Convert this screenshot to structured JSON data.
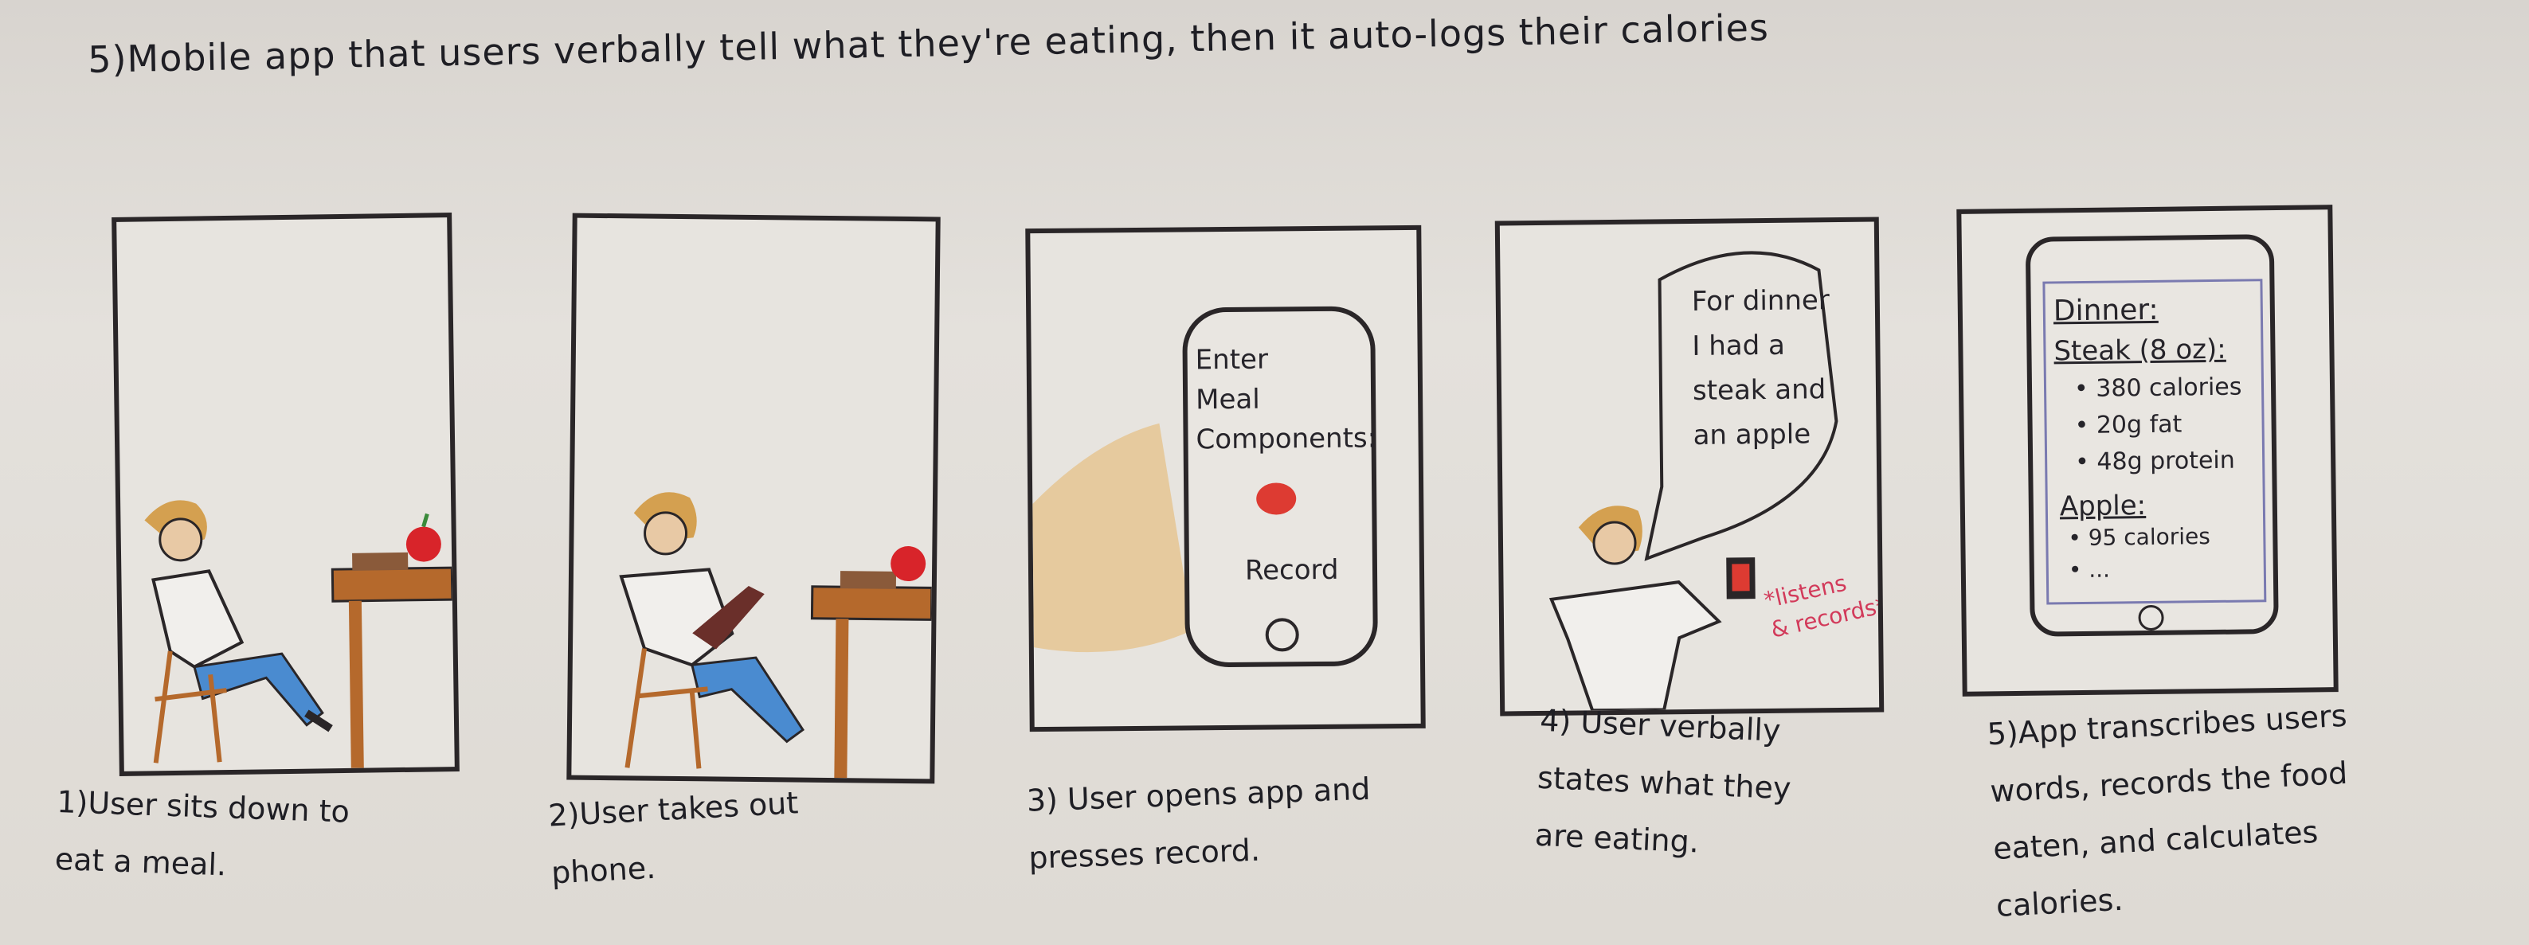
{
  "heading": "5)Mobile app that users verbally tell what they're eating, then it auto-logs their calories",
  "panels": [
    {
      "caption": "1)User sits down to\neat a meal."
    },
    {
      "caption": "2)User takes out\nphone."
    },
    {
      "caption": "3) User opens app and\npresses record.",
      "screen_prompt": "Enter\nMeal\nComponents:",
      "record_label": "Record"
    },
    {
      "caption": "4) User verbally\nstates what they\nare eating.",
      "speech": "For dinner\nI had a\nsteak and\nan apple",
      "note": "*listens\n& records*"
    },
    {
      "caption": "5)App transcribes users\nwords, records the food\neaten, and calculates\ncalories.",
      "log_title": "Dinner:",
      "log_item1": "Steak (8 oz):",
      "log_item1_lines": "• 380 calories\n• 20g fat\n• 48g protein",
      "log_item2": "Apple:",
      "log_item2_lines": "• 95 calories\n• ..."
    }
  ],
  "colors": {
    "ink": "#2a2628",
    "apple": "#d8242a",
    "jeans": "#4a8bd0",
    "table": "#b5692c",
    "hair": "#d4a050",
    "record": "#dd3b32"
  }
}
